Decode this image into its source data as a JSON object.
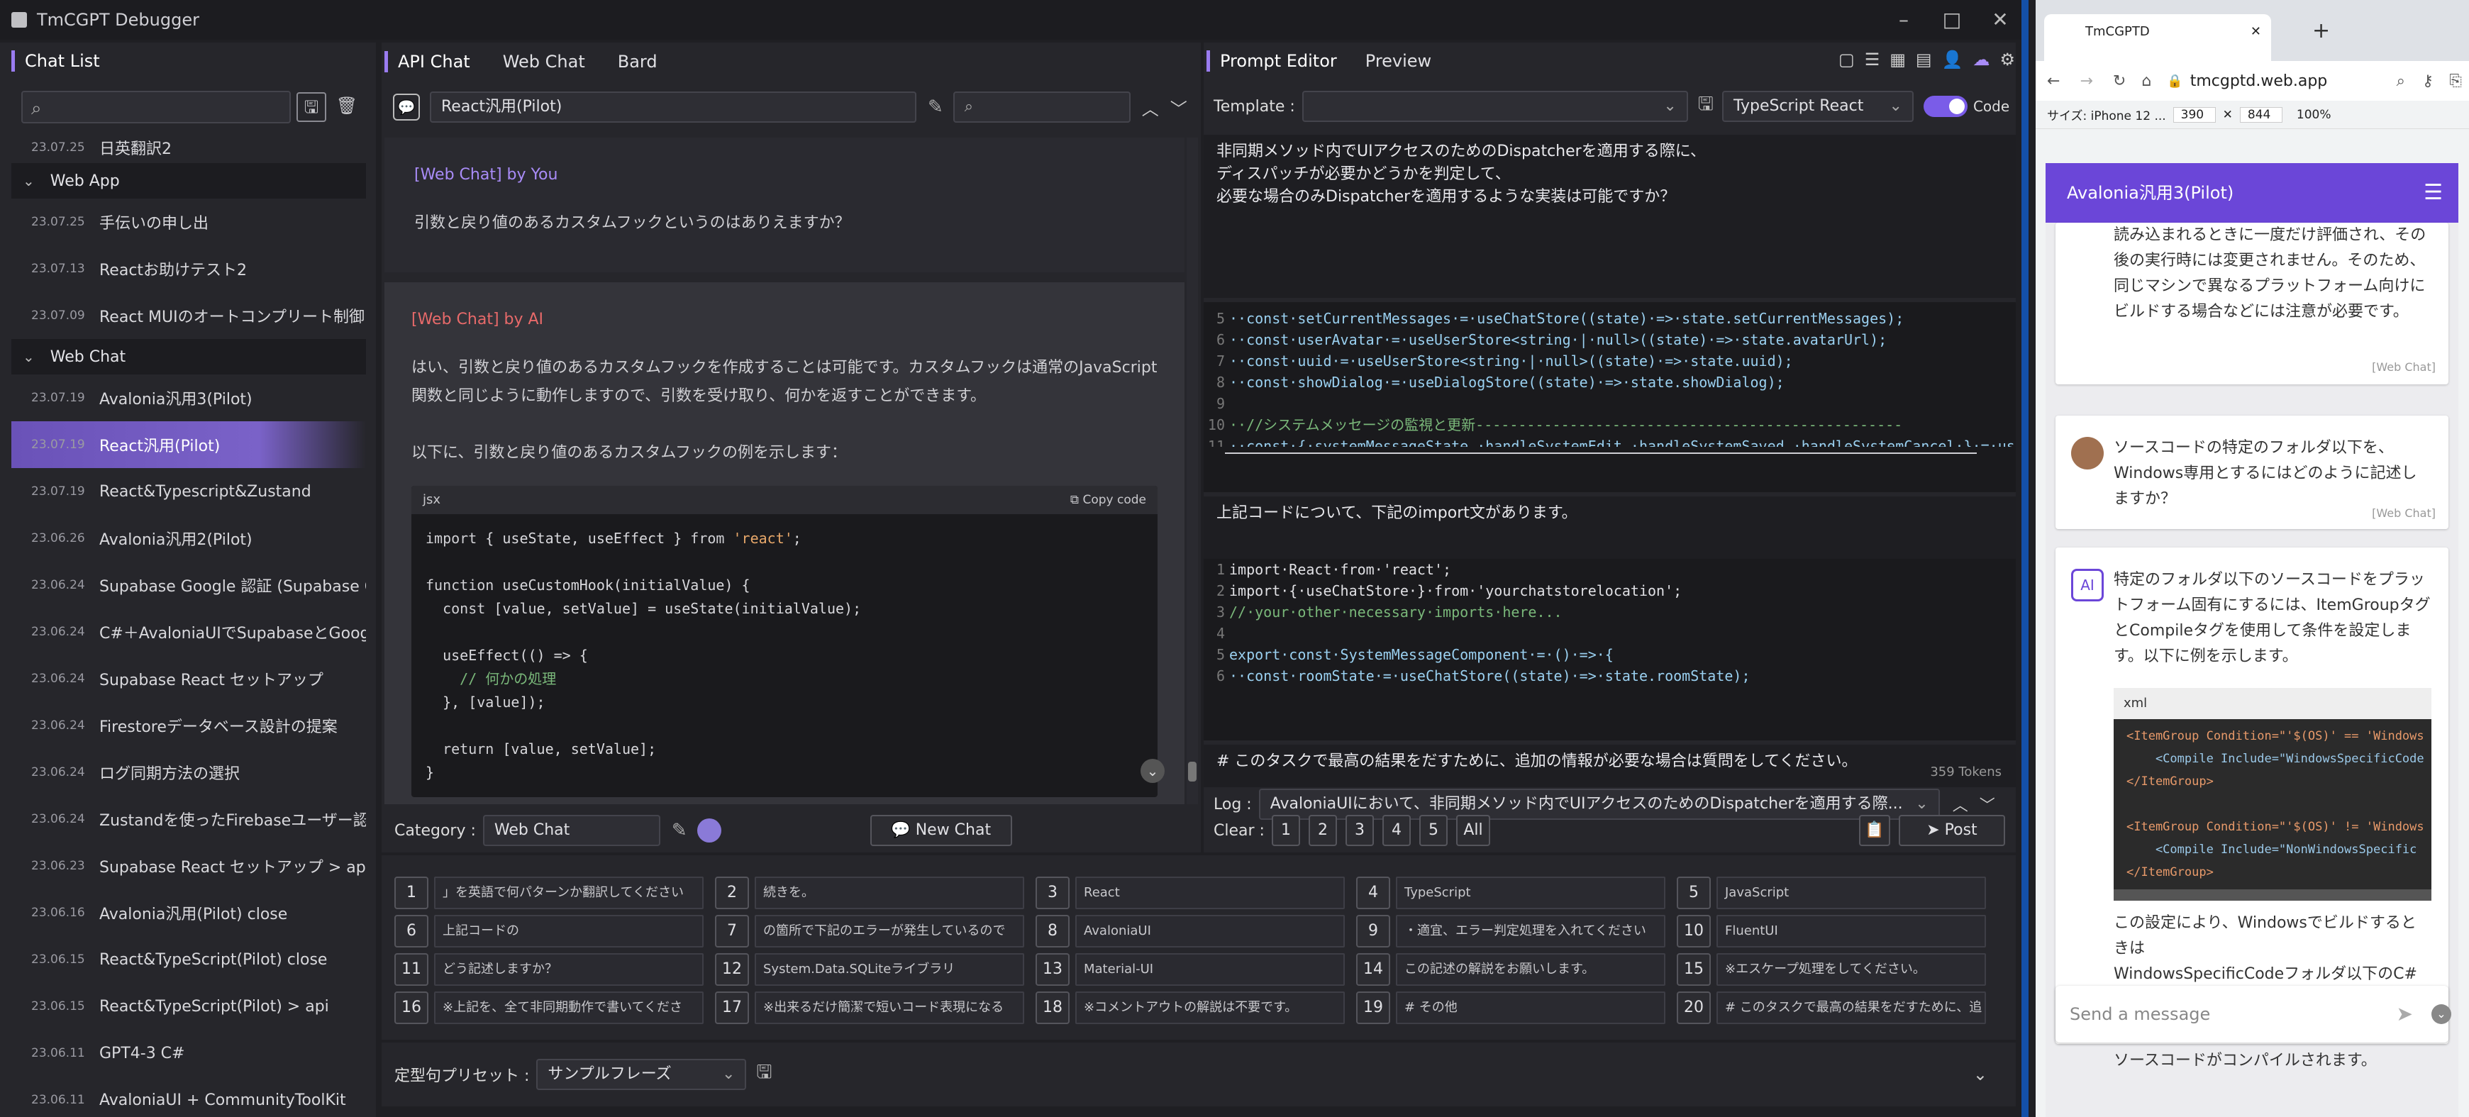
{
  "window": {
    "title": "TmCGPT Debugger"
  },
  "sidebar": {
    "tab_label": "Chat List",
    "groups": [
      {
        "type": "item",
        "date": "23.07.25",
        "title": "日英翻訳2"
      },
      {
        "type": "group",
        "title": "Web App"
      },
      {
        "type": "item",
        "date": "23.07.25",
        "title": "手伝いの申し出"
      },
      {
        "type": "item",
        "date": "23.07.13",
        "title": "Reactお助けテスト2"
      },
      {
        "type": "item",
        "date": "23.07.09",
        "title": "React MUIのオートコンプリート制御"
      },
      {
        "type": "group",
        "title": "Web Chat"
      },
      {
        "type": "item",
        "date": "23.07.19",
        "title": "Avalonia汎用3(Pilot)"
      },
      {
        "type": "item",
        "date": "23.07.19",
        "title": "React汎用(Pilot)",
        "selected": true
      },
      {
        "type": "item",
        "date": "23.07.19",
        "title": "React&Typescript&Zustand"
      },
      {
        "type": "item",
        "date": "23.06.26",
        "title": "Avalonia汎用2(Pilot)"
      },
      {
        "type": "item",
        "date": "23.06.24",
        "title": "Supabase Google 認証 (Supabase Google"
      },
      {
        "type": "item",
        "date": "23.06.24",
        "title": "C#＋AvaloniaUIでSupabaseとGoogle認証"
      },
      {
        "type": "item",
        "date": "23.06.24",
        "title": "Supabase React セットアップ"
      },
      {
        "type": "item",
        "date": "23.06.24",
        "title": "Firestoreデータベース設計の提案"
      },
      {
        "type": "item",
        "date": "23.06.24",
        "title": "ログ同期方法の選択"
      },
      {
        "type": "item",
        "date": "23.06.24",
        "title": "Zustandを使ったFirebaseユーザー認証"
      },
      {
        "type": "item",
        "date": "23.06.23",
        "title": "Supabase React セットアップ > api"
      },
      {
        "type": "item",
        "date": "23.06.16",
        "title": "Avalonia汎用(Pilot) close"
      },
      {
        "type": "item",
        "date": "23.06.15",
        "title": "React&TypeScript(Pilot) close"
      },
      {
        "type": "item",
        "date": "23.06.15",
        "title": "React&TypeScript(Pilot) > api"
      },
      {
        "type": "item",
        "date": "23.06.11",
        "title": "GPT4-3 C#"
      },
      {
        "type": "item",
        "date": "23.06.11",
        "title": "AvaloniaUI + CommunityToolKit"
      }
    ]
  },
  "chat": {
    "tabs": [
      "API Chat",
      "Web Chat",
      "Bard"
    ],
    "title_value": "React汎用(Pilot)",
    "you_label": "[Web Chat] by You",
    "you_text": "引数と戻り値のあるカスタムフックというのはありえますか？",
    "ai_label": "[Web Chat] by AI",
    "ai_text1": "はい、引数と戻り値のあるカスタムフックを作成することは可能です。カスタムフックは通常のJavaScript関数と同じように動作しますので、引数を受け取り、何かを返すことができます。",
    "ai_text2": "以下に、引数と戻り値のあるカスタムフックの例を示します：",
    "code_lang": "jsx",
    "copy_label": "Copy code",
    "category_label": "Category :",
    "category_value": "Web Chat",
    "new_chat_label": "New Chat"
  },
  "editor": {
    "tabs": [
      "Prompt Editor",
      "Preview"
    ],
    "template_label": "Template :",
    "lang_value": "TypeScript React",
    "code_toggle_label": "Code",
    "prompt1": "非同期メソッド内でUIアクセスのためのDispatcherを適用する際に、\nディスパッチが必要かどうかを判定して、\n必要な場合のみDispatcherを適用するような実装は可能ですか？",
    "code1": [
      {
        "n": "5",
        "t": "··const·setCurrentMessages·=·useChatStore((state)·=>·state.setCurrentMessages);"
      },
      {
        "n": "6",
        "t": "··const·userAvatar·=·useUserStore<string·|·null>((state)·=>·state.avatarUrl);"
      },
      {
        "n": "7",
        "t": "··const·uuid·=·useUserStore<string·|·null>((state)·=>·state.uuid);"
      },
      {
        "n": "8",
        "t": "··const·showDialog·=·useDialogStore((state)·=>·state.showDialog);"
      },
      {
        "n": "9",
        "t": ""
      },
      {
        "n": "10",
        "t": "··//システムメッセージの監視と更新--------------------------------------------------"
      },
      {
        "n": "11",
        "t": "··const·{·systemMessageState,·handleSystemEdit,·handleSystemSaved,·handleSystemCancel·}·=·useSyste"
      }
    ],
    "prompt2": "上記コードについて、下記のimport文があります。",
    "code2": [
      {
        "n": "1",
        "t": "import·React·from·'react';"
      },
      {
        "n": "2",
        "t": "import·{·useChatStore·}·from·'yourchatstorelocation';"
      },
      {
        "n": "3",
        "t": "//·your·other·necessary·imports·here..."
      },
      {
        "n": "4",
        "t": ""
      },
      {
        "n": "5",
        "t": "export·const·SystemMessageComponent·=·()·=>·{"
      },
      {
        "n": "6",
        "t": "··const·roomState·=·useChatStore((state)·=>·state.roomState);"
      }
    ],
    "prompt3": "# このタスクで最高の結果をだすために、追加の情報が必要な場合は質問をしてください。",
    "tokens": "359 Tokens",
    "log_label": "Log :",
    "log_value": "AvaloniaUIにおいて、非同期メソッド内でUIアクセスのためのDispatcherを適用する際...",
    "clear_label": "Clear :",
    "clear_buttons": [
      "1",
      "2",
      "3",
      "4",
      "5",
      "All"
    ],
    "post_label": "Post"
  },
  "snippets": [
    {
      "n": "1",
      "t": "」を英語で何パターンか翻訳してください"
    },
    {
      "n": "2",
      "t": "続きを。"
    },
    {
      "n": "3",
      "t": "React"
    },
    {
      "n": "4",
      "t": "TypeScript"
    },
    {
      "n": "5",
      "t": "JavaScript"
    },
    {
      "n": "6",
      "t": "上記コードの"
    },
    {
      "n": "7",
      "t": "の箇所で下記のエラーが発生しているので"
    },
    {
      "n": "8",
      "t": "AvaloniaUI"
    },
    {
      "n": "9",
      "t": "・適宜、エラー判定処理を入れてください"
    },
    {
      "n": "10",
      "t": "FluentUI"
    },
    {
      "n": "11",
      "t": "どう記述しますか？"
    },
    {
      "n": "12",
      "t": "System.Data.SQLiteライブラリ"
    },
    {
      "n": "13",
      "t": "Material-UI"
    },
    {
      "n": "14",
      "t": "この記述の解説をお願いします。"
    },
    {
      "n": "15",
      "t": "※エスケープ処理をしてください。"
    },
    {
      "n": "16",
      "t": "※上記を、全て非同期動作で書いてくださ"
    },
    {
      "n": "17",
      "t": "※出来るだけ簡潔で短いコード表現になる"
    },
    {
      "n": "18",
      "t": "※コメントアウトの解説は不要です。"
    },
    {
      "n": "19",
      "t": "# その他"
    },
    {
      "n": "20",
      "t": "# このタスクで最高の結果をだすために、追"
    }
  ],
  "preset": {
    "label": "定型句プリセット :",
    "value": "サンプルフレーズ"
  },
  "browser": {
    "tab_title": "TmCGPTD",
    "url": "tmcgptd.web.app",
    "device": "サイズ: iPhone 12 ...",
    "width": "390",
    "height": "844",
    "zoom": "100%",
    "app_title": "Avalonia汎用3(Pilot)",
    "card1_text": "読み込まれるときに一度だけ評価され、その後の実行時には変更されません。そのため、同じマシンで異なるプラットフォーム向けにビルドする場合などには注意が必要です。",
    "card_tag": "[Web Chat]",
    "card2_text": "ソースコードの特定のフォルダ以下を、Windows専用とするにはどのように記述しますか？",
    "card3_text": "特定のフォルダ以下のソースコードをプラットフォーム固有にするには、ItemGroupタグとCompileタグを使用して条件を設定します。以下に例を示します。",
    "code_lang": "xml",
    "code_lines": [
      "<ItemGroup Condition=\"'$(OS)' == 'Windows",
      "    <Compile Include=\"WindowsSpecificCode",
      "</ItemGroup>",
      "",
      "<ItemGroup Condition=\"'$(OS)' != 'Windows",
      "    <Compile Include=\"NonWindowsSpecific",
      "</ItemGroup>"
    ],
    "card3_text2": "この設定により、Windowsでビルドするときは",
    "card3_text3": "WindowsSpecificCodeフォルダ以下のC#ソースコ",
    "card3_text4": "ソースコードがコンパイルされます。",
    "send_placeholder": "Send a message"
  }
}
